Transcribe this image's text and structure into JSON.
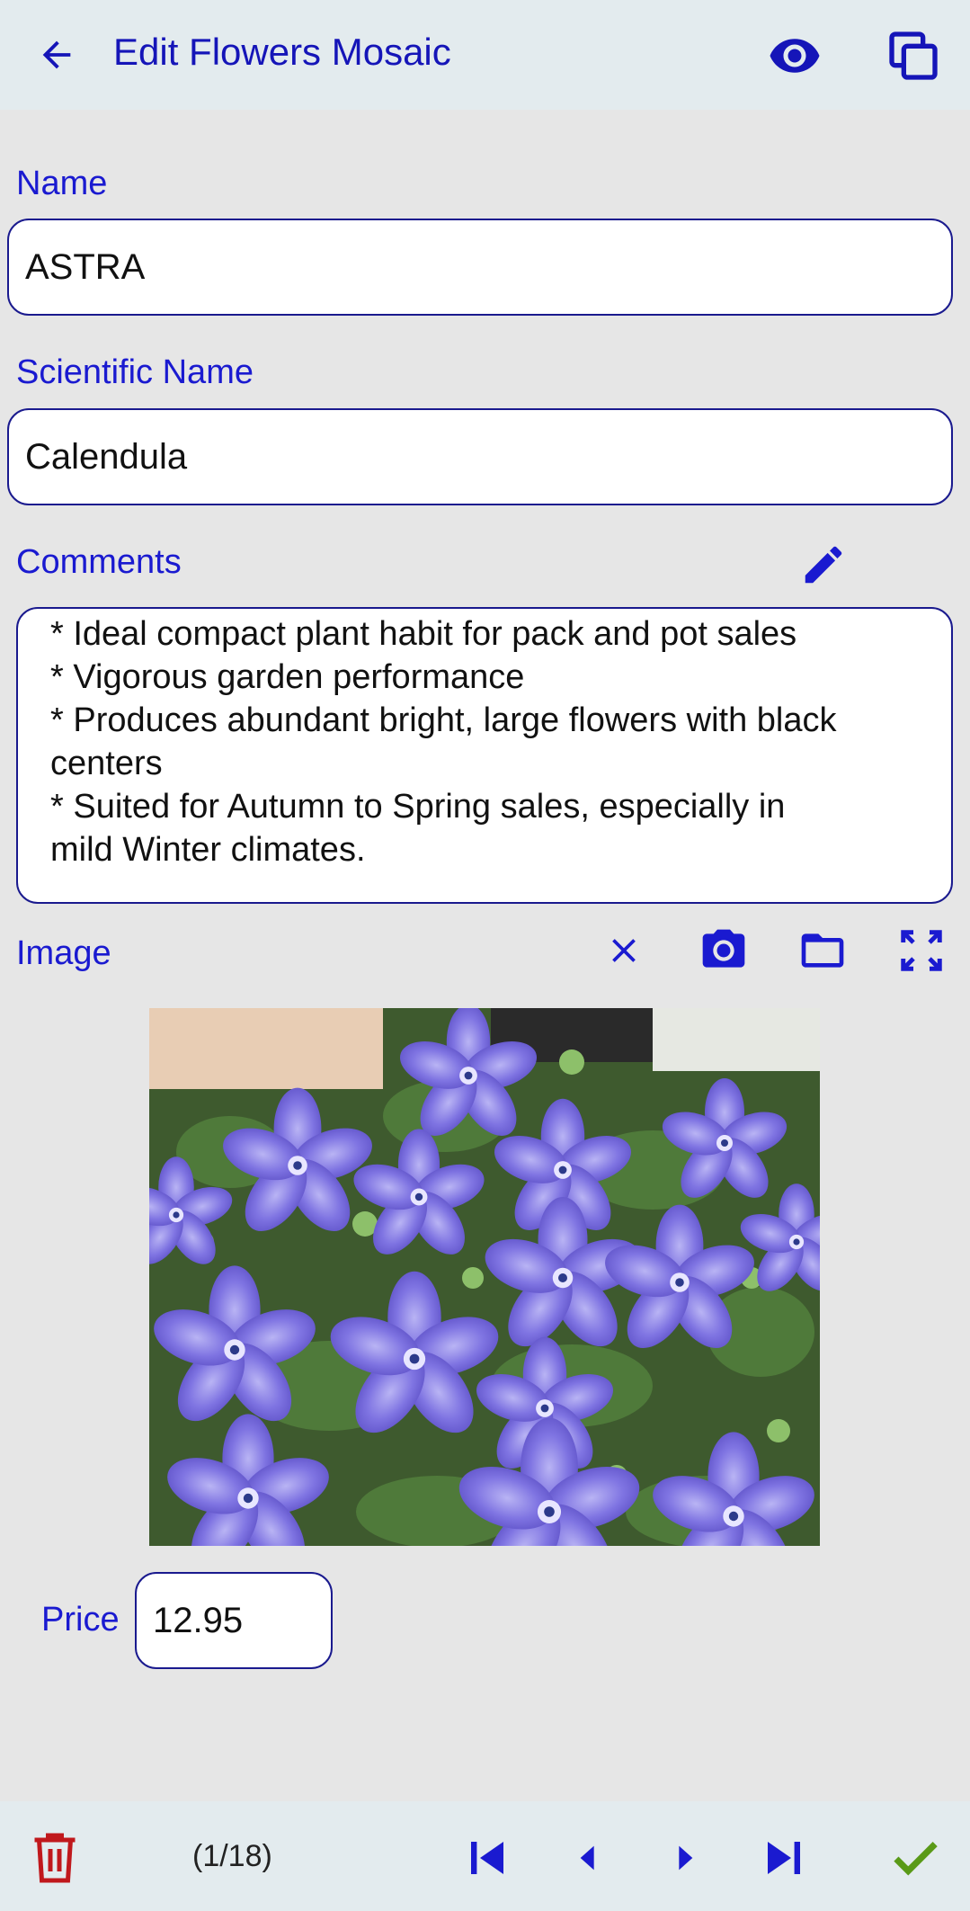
{
  "header": {
    "title": "Edit Flowers Mosaic"
  },
  "form": {
    "name_label": "Name",
    "name_value": "ASTRA",
    "scientific_label": "Scientific Name",
    "scientific_value": "Calendula",
    "comments_label": "Comments",
    "comments_lines": [
      "* Ideal compact plant habit for pack and pot sales",
      "* Vigorous garden performance",
      "* Produces abundant bright, large flowers with black",
      "centers",
      "* Suited for Autumn to Spring sales, especially in",
      "mild Winter climates."
    ],
    "image_label": "Image",
    "price_label": "Price",
    "price_value": "12.95"
  },
  "footer": {
    "counter": "(1/18)"
  },
  "colors": {
    "accent": "#1a1ad0",
    "delete": "#c0181c",
    "confirm": "#5a9a18"
  }
}
